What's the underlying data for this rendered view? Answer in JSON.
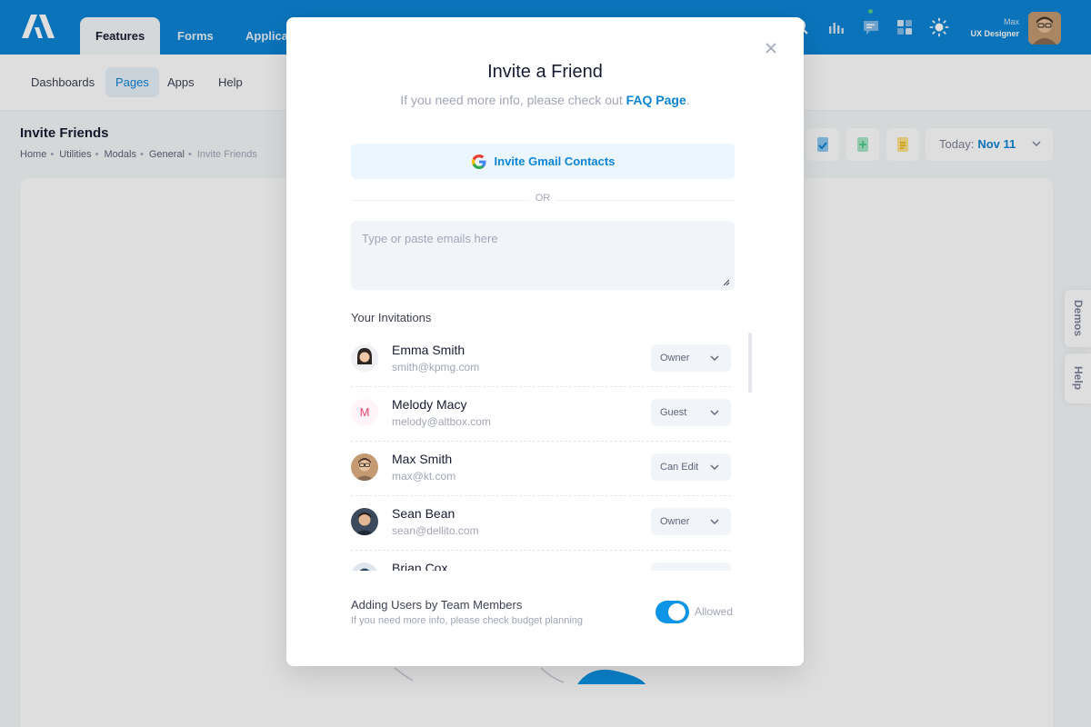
{
  "header": {
    "tabs": [
      {
        "label": "Features"
      },
      {
        "label": "Forms"
      },
      {
        "label": "Applica"
      }
    ],
    "user": {
      "name": "Max",
      "role": "UX Designer"
    }
  },
  "subnav": {
    "items": [
      {
        "label": "Dashboards"
      },
      {
        "label": "Pages"
      },
      {
        "label": "Apps"
      },
      {
        "label": "Help"
      }
    ]
  },
  "toolbar": {
    "title": "Invite Friends",
    "breadcrumb": [
      "Home",
      "Utilities",
      "Modals",
      "General",
      "Invite Friends"
    ],
    "date_label": "Today:",
    "date_value": "Nov 11"
  },
  "side_tabs": {
    "demos": "Demos",
    "help": "Help"
  },
  "modal": {
    "title": "Invite a Friend",
    "subtitle": "If you need more info, please check out",
    "subtitle_link": "FAQ Page",
    "gmail_button": "Invite Gmail Contacts",
    "or_text": "OR",
    "email_placeholder": "Type or paste emails here",
    "invitations_label": "Your Invitations",
    "invitations": [
      {
        "name": "Emma Smith",
        "email": "smith@kpmg.com",
        "role": "Owner"
      },
      {
        "name": "Melody Macy",
        "email": "melody@altbox.com",
        "role": "Guest",
        "initial": "M"
      },
      {
        "name": "Max Smith",
        "email": "max@kt.com",
        "role": "Can Edit"
      },
      {
        "name": "Sean Bean",
        "email": "sean@dellito.com",
        "role": "Owner"
      },
      {
        "name": "Brian Cox",
        "email": "",
        "role": ""
      }
    ],
    "permission_title": "Adding Users by Team Members",
    "permission_subtitle": "If you need more info, please check budget planning",
    "toggle_label": "Allowed",
    "toggle_on": true
  },
  "colors": {
    "primary": "#0c85d6",
    "header": "#0c85d6"
  },
  "icons": {
    "logo": "brand-logo",
    "close": "close-icon",
    "google": "google-icon",
    "chevron": "chevron-down-icon"
  }
}
